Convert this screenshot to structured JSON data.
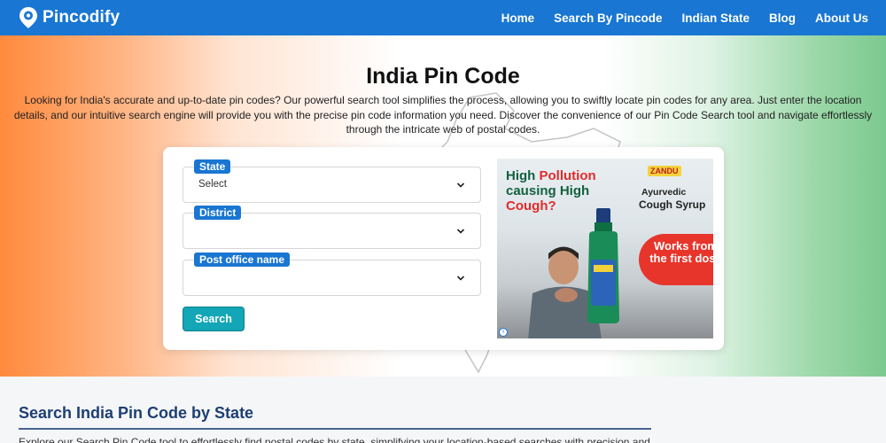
{
  "nav": {
    "brand": "Pincodify",
    "links": [
      "Home",
      "Search By Pincode",
      "Indian State",
      "Blog",
      "About Us"
    ]
  },
  "hero": {
    "title": "India Pin Code",
    "description": "Looking for India's accurate and up-to-date pin codes? Our powerful search tool simplifies the process, allowing you to swiftly locate pin codes for any area. Just enter the location details, and our intuitive search engine will provide you with the precise pin code information you need. Discover the convenience of our Pin Code Search tool and navigate effortlessly through the intricate web of postal codes."
  },
  "form": {
    "state": {
      "label": "State",
      "value": "Select"
    },
    "district": {
      "label": "District",
      "value": ""
    },
    "post_office": {
      "label": "Post office name",
      "value": ""
    },
    "search_label": "Search"
  },
  "ad": {
    "headline_1": "High ",
    "headline_1_accent": "Pollution",
    "headline_2": "causing High",
    "headline_3": "Cough?",
    "brand": "ZANDU",
    "product_1": "Ayurvedic",
    "product_2": "Cough Syrup",
    "badge": "Works from the first dose"
  },
  "section": {
    "title": "Search India Pin Code by State",
    "text": "Explore our Search Pin Code tool to effortlessly find postal codes by state, simplifying your location-based searches with precision and"
  },
  "colors": {
    "nav": "#1976d2",
    "accent_button": "#12a6b6",
    "section_title": "#1d3f73"
  }
}
